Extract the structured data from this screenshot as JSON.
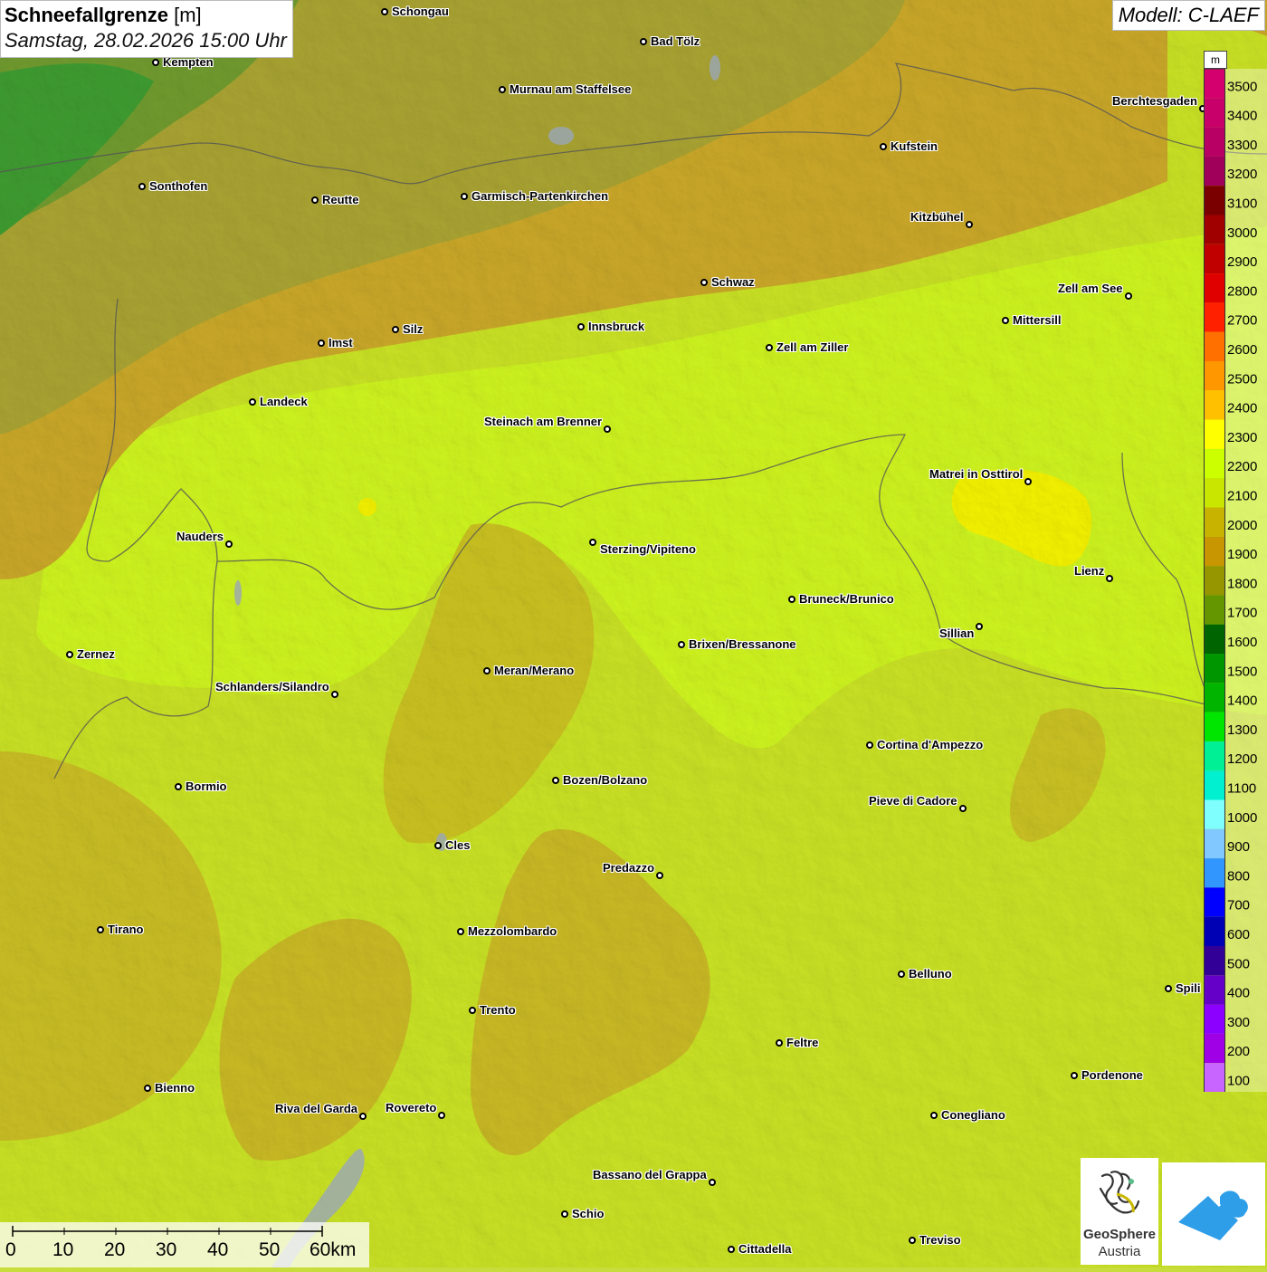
{
  "title": {
    "main": "Schneefallgrenze",
    "unit": "[m]",
    "datetime": "Samstag, 28.02.2026 15:00 Uhr"
  },
  "model": "Modell: C-LAEF",
  "legend": {
    "unit": "m",
    "entries": [
      {
        "label": "3500",
        "color": "#d4006e"
      },
      {
        "label": "3400",
        "color": "#c8006a"
      },
      {
        "label": "3300",
        "color": "#b80064"
      },
      {
        "label": "3200",
        "color": "#a0005a"
      },
      {
        "label": "3100",
        "color": "#7a0000"
      },
      {
        "label": "3000",
        "color": "#a00000"
      },
      {
        "label": "2900",
        "color": "#c00000"
      },
      {
        "label": "2800",
        "color": "#e00000"
      },
      {
        "label": "2700",
        "color": "#ff2000"
      },
      {
        "label": "2600",
        "color": "#ff7000"
      },
      {
        "label": "2500",
        "color": "#ff9800"
      },
      {
        "label": "2400",
        "color": "#ffc000"
      },
      {
        "label": "2300",
        "color": "#ffff00"
      },
      {
        "label": "2200",
        "color": "#ccff00"
      },
      {
        "label": "2100",
        "color": "#c8e600"
      },
      {
        "label": "2000",
        "color": "#c8b400"
      },
      {
        "label": "1900",
        "color": "#c89600"
      },
      {
        "label": "1800",
        "color": "#969600"
      },
      {
        "label": "1700",
        "color": "#649600"
      },
      {
        "label": "1600",
        "color": "#006400"
      },
      {
        "label": "1500",
        "color": "#009600"
      },
      {
        "label": "1400",
        "color": "#00b400"
      },
      {
        "label": "1300",
        "color": "#00e600"
      },
      {
        "label": "1200",
        "color": "#00f096"
      },
      {
        "label": "1100",
        "color": "#00f0d0"
      },
      {
        "label": "1000",
        "color": "#80ffff"
      },
      {
        "label": "900",
        "color": "#80c8ff"
      },
      {
        "label": "800",
        "color": "#3296ff"
      },
      {
        "label": "700",
        "color": "#0000ff"
      },
      {
        "label": "600",
        "color": "#0000b4"
      },
      {
        "label": "500",
        "color": "#320096"
      },
      {
        "label": "400",
        "color": "#6400c8"
      },
      {
        "label": "300",
        "color": "#8c00ff"
      },
      {
        "label": "200",
        "color": "#a000e6"
      },
      {
        "label": "100",
        "color": "#c864ff"
      }
    ]
  },
  "scale": {
    "labels": [
      "0",
      "10",
      "20",
      "30",
      "40",
      "50",
      "60km"
    ]
  },
  "logo": {
    "line1": "GeoSphere",
    "line2": "Austria"
  },
  "cities": [
    {
      "name": "Schongau"
    },
    {
      "name": "Bad Tölz"
    },
    {
      "name": "Kempten"
    },
    {
      "name": "Murnau am Staffelsee"
    },
    {
      "name": "Berchtesgaden"
    },
    {
      "name": "Kufstein"
    },
    {
      "name": "Sonthofen"
    },
    {
      "name": "Reutte"
    },
    {
      "name": "Garmisch-Partenkirchen"
    },
    {
      "name": "Kitzbühel"
    },
    {
      "name": "Schwaz"
    },
    {
      "name": "Zell am See"
    },
    {
      "name": "Innsbruck"
    },
    {
      "name": "Mittersill"
    },
    {
      "name": "Imst"
    },
    {
      "name": "Silz"
    },
    {
      "name": "Zell am Ziller"
    },
    {
      "name": "Landeck"
    },
    {
      "name": "Steinach am Brenner"
    },
    {
      "name": "Matrei in Osttirol"
    },
    {
      "name": "Nauders"
    },
    {
      "name": "Sterzing/Vipiteno"
    },
    {
      "name": "Lienz"
    },
    {
      "name": "Bruneck/Brunico"
    },
    {
      "name": "Sillian"
    },
    {
      "name": "Zernez"
    },
    {
      "name": "Brixen/Bressanone"
    },
    {
      "name": "Meran/Merano"
    },
    {
      "name": "Schlanders/Silandro"
    },
    {
      "name": "Cortina d'Ampezzo"
    },
    {
      "name": "Bormio"
    },
    {
      "name": "Bozen/Bolzano"
    },
    {
      "name": "Pieve di Cadore"
    },
    {
      "name": "Cles"
    },
    {
      "name": "Predazzo"
    },
    {
      "name": "Tirano"
    },
    {
      "name": "Mezzolombardo"
    },
    {
      "name": "Belluno"
    },
    {
      "name": "Spili"
    },
    {
      "name": "Trento"
    },
    {
      "name": "Feltre"
    },
    {
      "name": "Pordenone"
    },
    {
      "name": "Bienno"
    },
    {
      "name": "Riva del Garda"
    },
    {
      "name": "Rovereto"
    },
    {
      "name": "Conegliano"
    },
    {
      "name": "Bassano del Grappa"
    },
    {
      "name": "Schio"
    },
    {
      "name": "Treviso"
    },
    {
      "name": "Cittadella"
    }
  ]
}
